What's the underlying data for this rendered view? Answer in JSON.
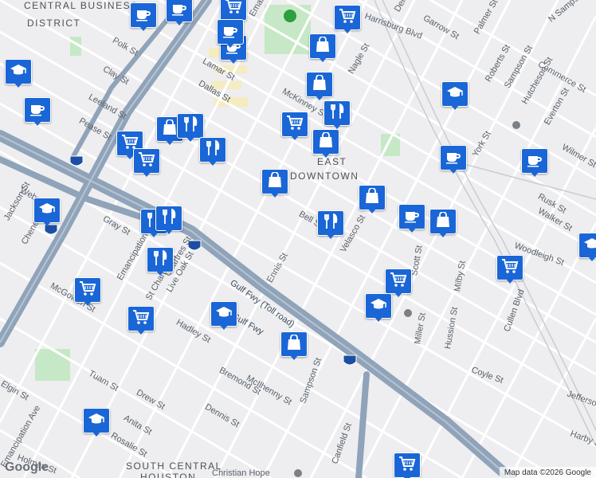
{
  "map": {
    "area_labels": [
      "CENTRAL BUSINESS",
      "DISTRICT",
      "EAST",
      "DOWNTOWN",
      "SOUTH CENTRAL",
      "HOUSTON"
    ],
    "street_labels": [
      "Polk St",
      "Clay St",
      "Leeland St",
      "Pease St",
      "Lamar St",
      "Dallas St",
      "McKinney St",
      "Gray St",
      "Webster St",
      "Jackson St",
      "Chenevert St",
      "Emancipation Ave",
      "Live Oak St",
      "St Charles St",
      "Hadley St",
      "McGowen St",
      "Tuam St",
      "Drew St",
      "Elgin St",
      "Dennis St",
      "Anita St",
      "Rosalie St",
      "McIlhenny St",
      "Bremond St",
      "Sampson St",
      "Canfield St",
      "Bell St",
      "Velasco St",
      "Nagle St",
      "Ennis St",
      "Scott St",
      "Harrisburg Blvd",
      "Delano St",
      "Garrow St",
      "Palmer St",
      "Roberts St",
      "Commerce St",
      "Sampson St",
      "Hutcheson St",
      "Everton St",
      "Wilmer St",
      "York St",
      "Rusk St",
      "Walker St",
      "Cullen Blvd",
      "Miller St",
      "Hussion St",
      "Coyle St",
      "Milby St",
      "Jefferson St",
      "Harby St",
      "Holman St",
      "Christian Hope",
      "Emanuel St",
      "Emancipation Ave",
      "Chartres St",
      "N Sampson St",
      "Woodleigh St",
      "Gulf Fwy",
      "Gulf Fwy (Toll road)"
    ],
    "highway_shields": [
      "45",
      "69",
      "45",
      "45"
    ],
    "attribution": "Map data ©2026 Google",
    "logo": "Google"
  },
  "markers": [
    {
      "icon": "coffee-icon"
    },
    {
      "icon": "coffee-icon"
    },
    {
      "icon": "grocery-cart-icon"
    },
    {
      "icon": "grocery-cart-icon"
    },
    {
      "icon": "coffee-icon"
    },
    {
      "icon": "shopping-bag-icon"
    },
    {
      "icon": "coffee-icon"
    },
    {
      "icon": "school-icon"
    },
    {
      "icon": "coffee-icon"
    },
    {
      "icon": "shopping-bag-icon"
    },
    {
      "icon": "restaurant-icon"
    },
    {
      "icon": "grocery-cart-icon"
    },
    {
      "icon": "shopping-bag-icon"
    },
    {
      "icon": "restaurant-icon"
    },
    {
      "icon": "grocery-cart-icon"
    },
    {
      "icon": "grocery-cart-icon"
    },
    {
      "icon": "restaurant-icon"
    },
    {
      "icon": "shopping-bag-icon"
    },
    {
      "icon": "shopping-bag-icon"
    },
    {
      "icon": "school-icon"
    },
    {
      "icon": "restaurant-icon"
    },
    {
      "icon": "shopping-bag-icon"
    },
    {
      "icon": "restaurant-icon"
    },
    {
      "icon": "restaurant-icon"
    },
    {
      "icon": "grocery-cart-icon"
    },
    {
      "icon": "coffee-icon"
    },
    {
      "icon": "shopping-bag-icon"
    },
    {
      "icon": "school-icon"
    },
    {
      "icon": "coffee-icon"
    },
    {
      "icon": "grocery-cart-icon"
    },
    {
      "icon": "grocery-cart-icon"
    },
    {
      "icon": "school-icon"
    },
    {
      "icon": "school-icon"
    },
    {
      "icon": "restaurant-icon"
    },
    {
      "icon": "shopping-bag-icon"
    },
    {
      "icon": "school-icon"
    },
    {
      "icon": "coffee-icon"
    },
    {
      "icon": "grocery-cart-icon"
    },
    {
      "icon": "school-icon"
    },
    {
      "icon": "grocery-cart-icon"
    }
  ],
  "colors": {
    "background": "#eeeef0",
    "freeway": "#8fa3b9",
    "park": "#c6e8c6",
    "marker": "#1a66d6"
  }
}
